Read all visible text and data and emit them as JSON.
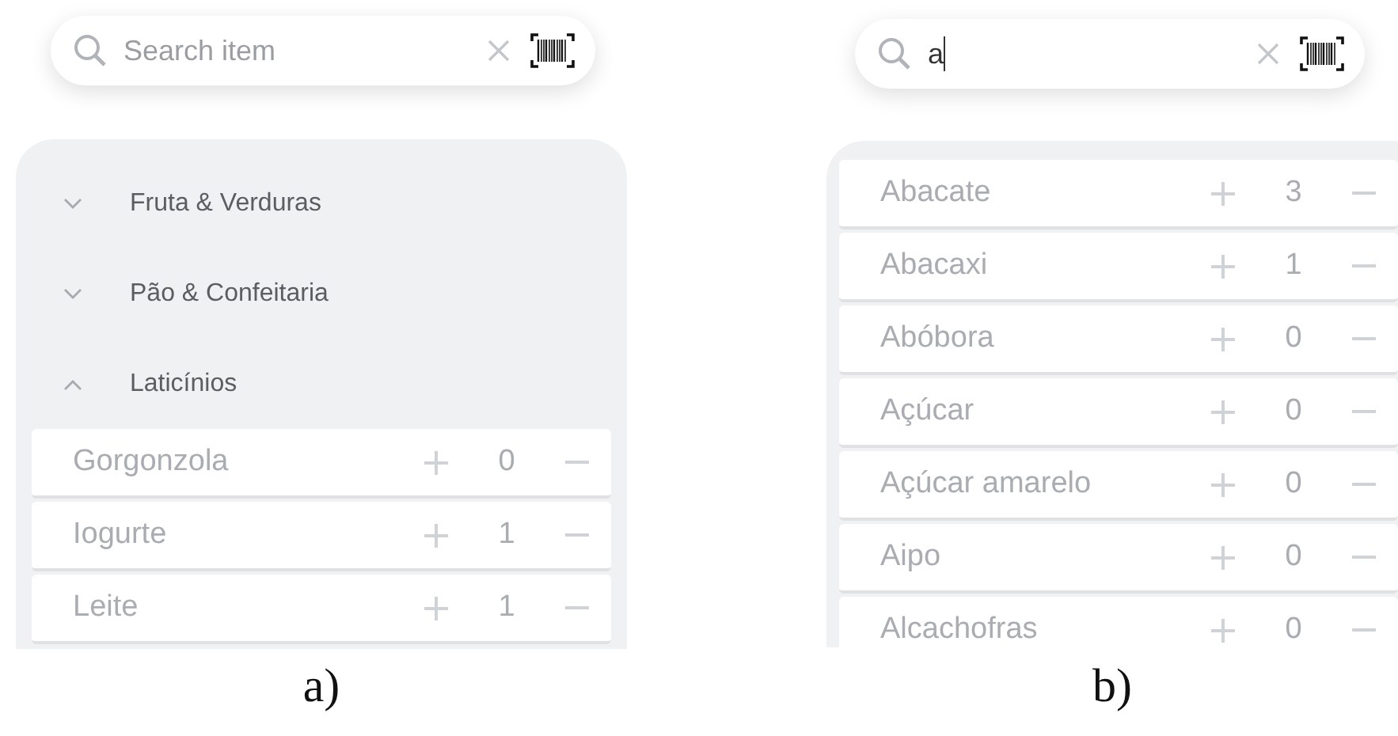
{
  "panels": [
    {
      "kind": "categories",
      "caption": "a)",
      "search": {
        "placeholder": "Search item"
      },
      "categories": [
        {
          "name": "Fruta & Verduras",
          "expanded": false
        },
        {
          "name": "Pão & Confeitaria",
          "expanded": false
        },
        {
          "name": "Laticínios",
          "expanded": true,
          "items": [
            {
              "name": "Gorgonzola",
              "count": "0"
            },
            {
              "name": "Iogurte",
              "count": "1"
            },
            {
              "name": "Leite",
              "count": "1"
            }
          ]
        }
      ]
    },
    {
      "kind": "results",
      "caption": "b)",
      "search": {
        "value": "a"
      },
      "items": [
        {
          "name": "Abacate",
          "count": "3"
        },
        {
          "name": "Abacaxi",
          "count": "1"
        },
        {
          "name": "Abóbora",
          "count": "0"
        },
        {
          "name": "Açúcar",
          "count": "0"
        },
        {
          "name": "Açúcar amarelo",
          "count": "0"
        },
        {
          "name": "Aipo",
          "count": "0"
        },
        {
          "name": "Alcachofras",
          "count": "0"
        }
      ]
    }
  ]
}
